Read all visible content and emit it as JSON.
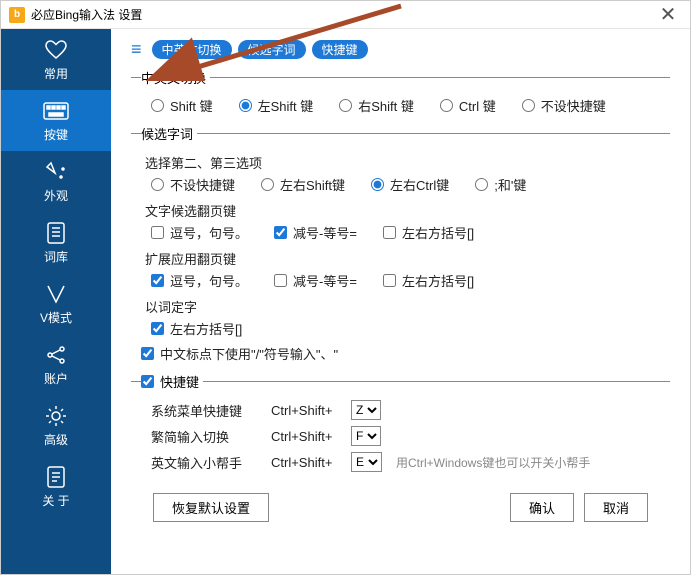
{
  "window": {
    "title": "必应Bing输入法 设置",
    "logo_letter": "b",
    "close": "✕"
  },
  "sidebar": {
    "items": [
      {
        "label": "常用"
      },
      {
        "label": "按键"
      },
      {
        "label": "外观"
      },
      {
        "label": "词库"
      },
      {
        "label": "V模式"
      },
      {
        "label": "账户"
      },
      {
        "label": "高级"
      },
      {
        "label": "关 于"
      }
    ],
    "active_index": 1
  },
  "tabs": {
    "t1": "中英文切换",
    "t2": "候选字词",
    "t3": "快捷键"
  },
  "section_cn_en": {
    "legend": "中英文切换",
    "options": [
      "Shift 键",
      "左Shift 键",
      "右Shift 键",
      "Ctrl 键",
      "不设快捷键"
    ],
    "selected": 1
  },
  "section_candidate": {
    "legend": "候选字词",
    "subhead1": "选择第二、第三选项",
    "row1": {
      "options": [
        "不设快捷键",
        "左右Shift键",
        "左右Ctrl键",
        ";和'键"
      ],
      "selected": 2
    },
    "subhead2": "文字候选翻页键",
    "row2": {
      "opts": [
        "逗号，句号。",
        "减号-等号=",
        "左右方括号[]"
      ],
      "checked": [
        false,
        true,
        false
      ]
    },
    "subhead3": "扩展应用翻页键",
    "row3": {
      "opts": [
        "逗号，句号。",
        "减号-等号=",
        "左右方括号[]"
      ],
      "checked": [
        true,
        false,
        false
      ]
    },
    "subhead4": "以词定字",
    "row4": {
      "opt": "左右方括号[]",
      "checked": true
    },
    "row5": {
      "opt": "中文标点下使用\"/\"符号输入\"、\"",
      "checked": true
    }
  },
  "section_hotkey": {
    "legend": "快捷键",
    "legend_checked": true,
    "rows": [
      {
        "label": "系统菜单快捷键",
        "combo": "Ctrl+Shift+",
        "value": "Z",
        "hint": ""
      },
      {
        "label": "繁简输入切换",
        "combo": "Ctrl+Shift+",
        "value": "F",
        "hint": ""
      },
      {
        "label": "英文输入小帮手",
        "combo": "Ctrl+Shift+",
        "value": "E",
        "hint": "用Ctrl+Windows键也可以开关小帮手"
      }
    ]
  },
  "footer": {
    "restore": "恢复默认设置",
    "ok": "确认",
    "cancel": "取消"
  }
}
